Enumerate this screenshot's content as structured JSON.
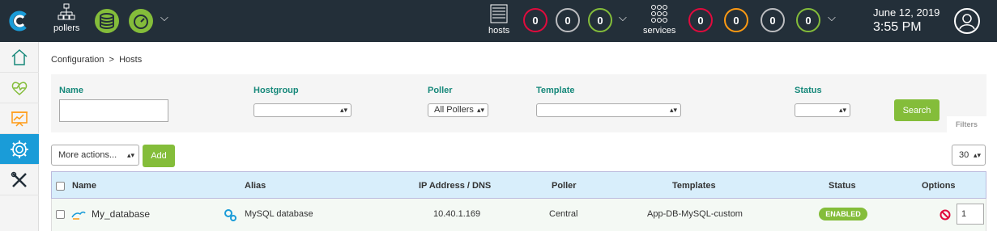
{
  "topbar": {
    "pollers_label": "pollers",
    "hosts_label": "hosts",
    "services_label": "services",
    "host_counts": [
      "0",
      "0",
      "0"
    ],
    "service_counts": [
      "0",
      "0",
      "0",
      "0"
    ],
    "date": "June 12, 2019",
    "time": "3:55 PM",
    "colors": {
      "critical": "#e00b3d",
      "warning": "#ff9a13",
      "unknown": "#bcbdc0",
      "ok": "#84bd3a",
      "unreachable": "#818285"
    }
  },
  "sidebar": {
    "items": [
      {
        "icon": "home-icon"
      },
      {
        "icon": "monitoring-icon"
      },
      {
        "icon": "reporting-icon"
      },
      {
        "icon": "configuration-icon"
      },
      {
        "icon": "administration-icon"
      }
    ]
  },
  "breadcrumb": "Configuration  >  Hosts",
  "filters": {
    "name_label": "Name",
    "hostgroup_label": "Hostgroup",
    "poller_label": "Poller",
    "poller_value": "All Pollers",
    "template_label": "Template",
    "status_label": "Status",
    "search_label": "Search",
    "filters_tab": "Filters"
  },
  "actions": {
    "more_actions": "More actions...",
    "add_label": "Add",
    "page_size": "30"
  },
  "table": {
    "headers": [
      "Name",
      "Alias",
      "IP Address / DNS",
      "Poller",
      "Templates",
      "Status",
      "Options"
    ],
    "rows": [
      {
        "name": "My_database",
        "alias": "MySQL database",
        "ip": "10.40.1.169",
        "poller": "Central",
        "templates": "App-DB-MySQL-custom",
        "status": "ENABLED",
        "options_value": "1"
      }
    ]
  }
}
